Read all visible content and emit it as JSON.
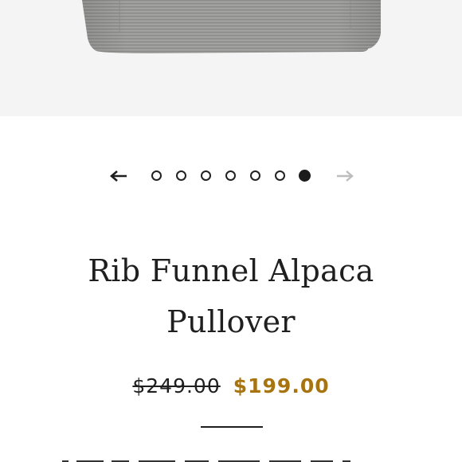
{
  "product": {
    "title_line1": "Rib Funnel Alpaca",
    "title_line2": "Pullover",
    "compare_price": "$249.00",
    "sale_price": "$199.00"
  },
  "carousel": {
    "slide_count": 7,
    "active_slide": 7,
    "prev_icon": "arrow-left-icon",
    "next_icon": "arrow-right-icon"
  },
  "colors": {
    "sale_price": "#a8740f",
    "text": "#1f1f1f",
    "hero_background": "#f4f4f4",
    "sweater": "#9a9a98"
  }
}
